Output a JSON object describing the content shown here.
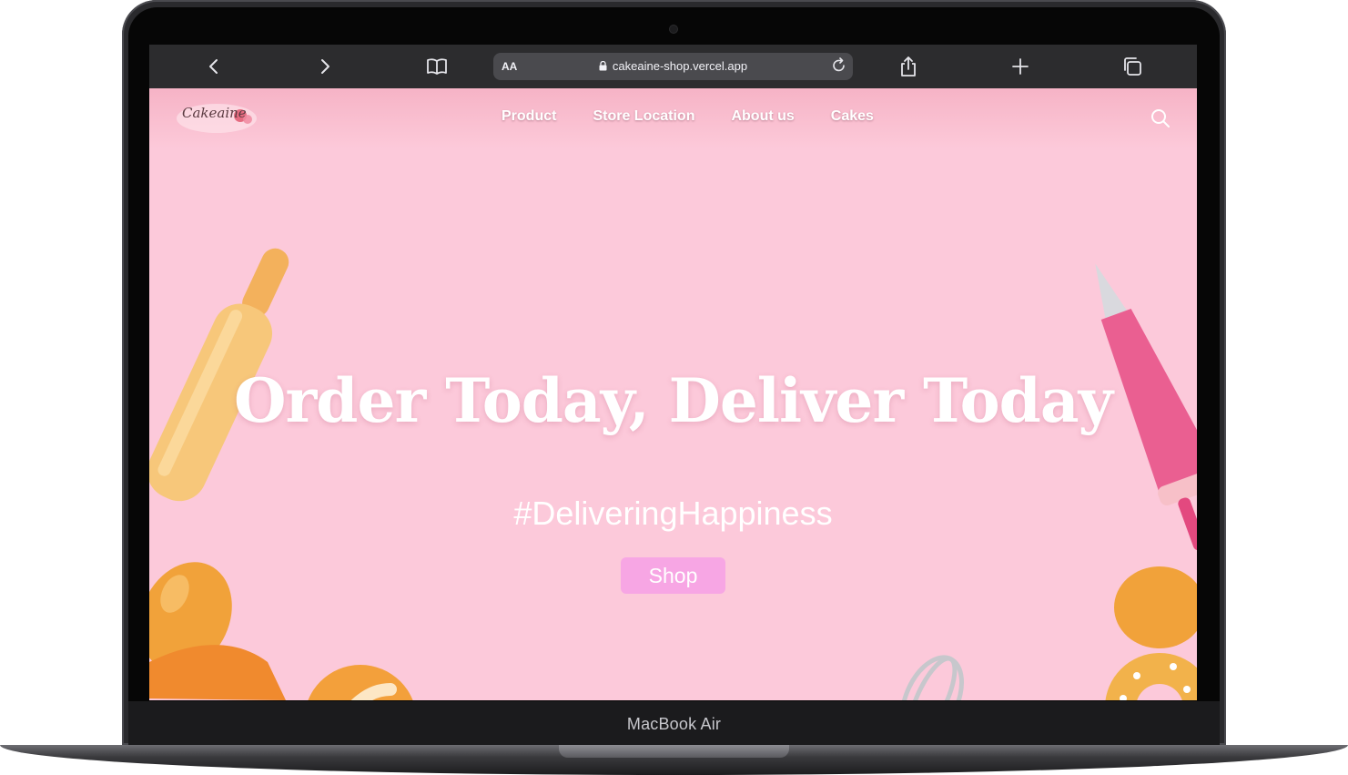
{
  "device": {
    "label": "MacBook Air"
  },
  "browser": {
    "text_size_label": "AA",
    "url": "cakeaine-shop.vercel.app",
    "icons": [
      "back-icon",
      "forward-icon",
      "bookmarks-icon",
      "lock-icon",
      "reload-icon",
      "share-icon",
      "new-tab-icon",
      "tabs-icon"
    ]
  },
  "site": {
    "logo_text": "Cakeaine",
    "nav": [
      {
        "label": "Product"
      },
      {
        "label": "Store Location"
      },
      {
        "label": "About us"
      },
      {
        "label": "Cakes"
      }
    ],
    "hero": {
      "title": "Order Today, Deliver Today",
      "tagline": "#DeliveringHappiness",
      "cta_label": "Shop"
    },
    "colors": {
      "background": "#fcc9da",
      "cta": "#f7a6e4",
      "browser_bar": "#2c2c2e"
    }
  }
}
